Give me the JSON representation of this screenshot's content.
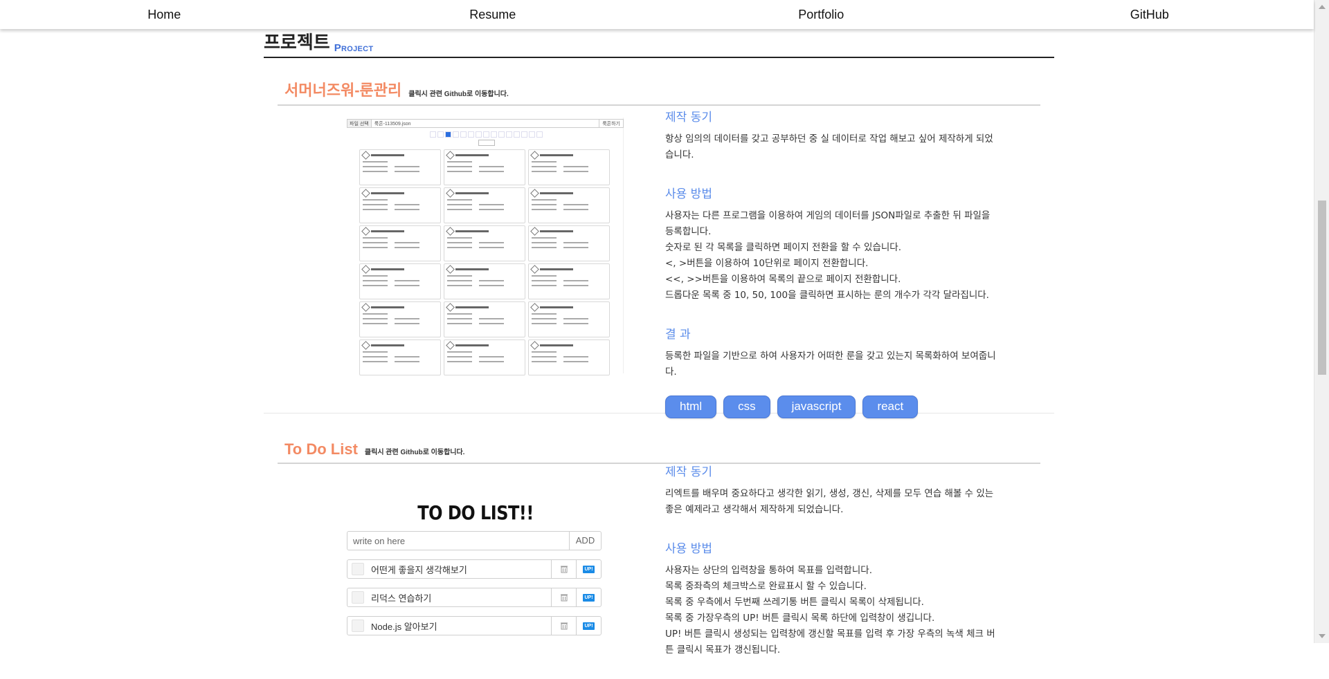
{
  "nav": {
    "items": [
      "Home",
      "Resume",
      "Portfolio",
      "GitHub"
    ]
  },
  "section": {
    "title": "프로젝트",
    "subtitle": "Project"
  },
  "projects": [
    {
      "title": "서머너즈워-룬관리",
      "hint": "클릭시 관련 Github로 이동합니다.",
      "screenshot": {
        "file_button": "파일 선택",
        "file_name": "룩흔-113509.json",
        "search_button": "룩흔하기"
      },
      "motive_heading": "제작 동기",
      "motive": "항상 임의의 데이터를 갖고 공부하던 중 실 데이터로 작업 해보고 싶어 제작하게 되었습니다.",
      "usage_heading": "사용 방법",
      "usage": [
        "사용자는 다른 프로그램을 이용하여 게임의 데이터를 JSON파일로 추출한 뒤 파일을 등록합니다.",
        "숫자로 된 각 목록을 클릭하면 페이지 전환을 할 수 있습니다.",
        "<, >버튼을 이용하여 10단위로 페이지 전환합니다.",
        "<<, >>버튼을 이용하여 목록의 끝으로 페이지 전환합니다.",
        "드롭다운 목록 중 10, 50, 100을 클릭하면 표시하는 룬의 개수가 각각 달라집니다."
      ],
      "result_heading": "결 과",
      "result": "등록한 파일을 기반으로 하여 사용자가 어떠한 룬을 갖고 있는지 목록화하여 보여줍니다.",
      "tags": [
        "html",
        "css",
        "javascript",
        "react"
      ]
    },
    {
      "title": "To Do List",
      "hint": "클릭시 관련 Github로 이동합니다.",
      "screenshot": {
        "title": "TO DO LIST!!",
        "input_placeholder": "write on here",
        "add_button": "ADD",
        "items": [
          "어떤게 좋을지 생각해보기",
          "리덕스 연습하기",
          "Node.js 알아보기"
        ],
        "up_label": "UP!"
      },
      "motive_heading": "제작 동기",
      "motive": "리엑트를 배우며 중요하다고 생각한 읽기, 생성, 갱신, 삭제를 모두 연습 해볼 수 있는 좋은 예제라고 생각해서 제작하게 되었습니다.",
      "usage_heading": "사용 방법",
      "usage": [
        "사용자는 상단의 입력창을 통하여 목표를 입력합니다.",
        "목록 중좌측의 체크박스로 완료표시 할 수 있습니다.",
        "목록 중 우측에서 두번째 쓰레기통 버튼 클릭시 목록이 삭제됩니다.",
        "목록 중 가장우측의 UP! 버튼 클릭시 목록 하단에 입력창이 생깁니다.",
        "UP! 버튼 클릭시 생성되는 입력창에 갱신할 목표를 입력 후 가장 우측의 녹색 체크 버튼 클릭시 목표가 갱신됩니다."
      ]
    }
  ]
}
